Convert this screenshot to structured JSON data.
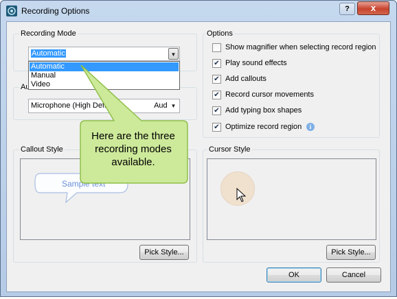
{
  "window": {
    "title": "Recording Options",
    "help_label": "?",
    "close_label": "x"
  },
  "recording_mode": {
    "group_label": "Recording Mode",
    "selected": "Automatic",
    "options": [
      "Automatic",
      "Manual",
      "Video"
    ]
  },
  "audio": {
    "group_label_visible": "Au",
    "device_visible": "Microphone (High Defin",
    "device_visible_tail": "Aud"
  },
  "options": {
    "group_label": "Options",
    "items": [
      {
        "label": "Show magnifier when selecting record region",
        "checked": false
      },
      {
        "label": "Play sound effects",
        "checked": true
      },
      {
        "label": "Add callouts",
        "checked": true
      },
      {
        "label": "Record cursor movements",
        "checked": true
      },
      {
        "label": "Add typing box shapes",
        "checked": true
      },
      {
        "label": "Optimize record region",
        "checked": true
      }
    ],
    "info_icon": "info-icon"
  },
  "callout_style": {
    "group_label": "Callout Style",
    "sample_text": "Sample text",
    "pick_label": "Pick Style..."
  },
  "cursor_style": {
    "group_label": "Cursor Style",
    "pick_label": "Pick Style..."
  },
  "footer": {
    "ok_label": "OK",
    "cancel_label": "Cancel"
  },
  "tooltip": {
    "text": "Here are the three recording modes available."
  },
  "colors": {
    "accent_selection": "#3399ff",
    "tooltip_fill": "#cde99a",
    "tooltip_border": "#8fbf4a",
    "sample_text": "#6a8fd8"
  }
}
